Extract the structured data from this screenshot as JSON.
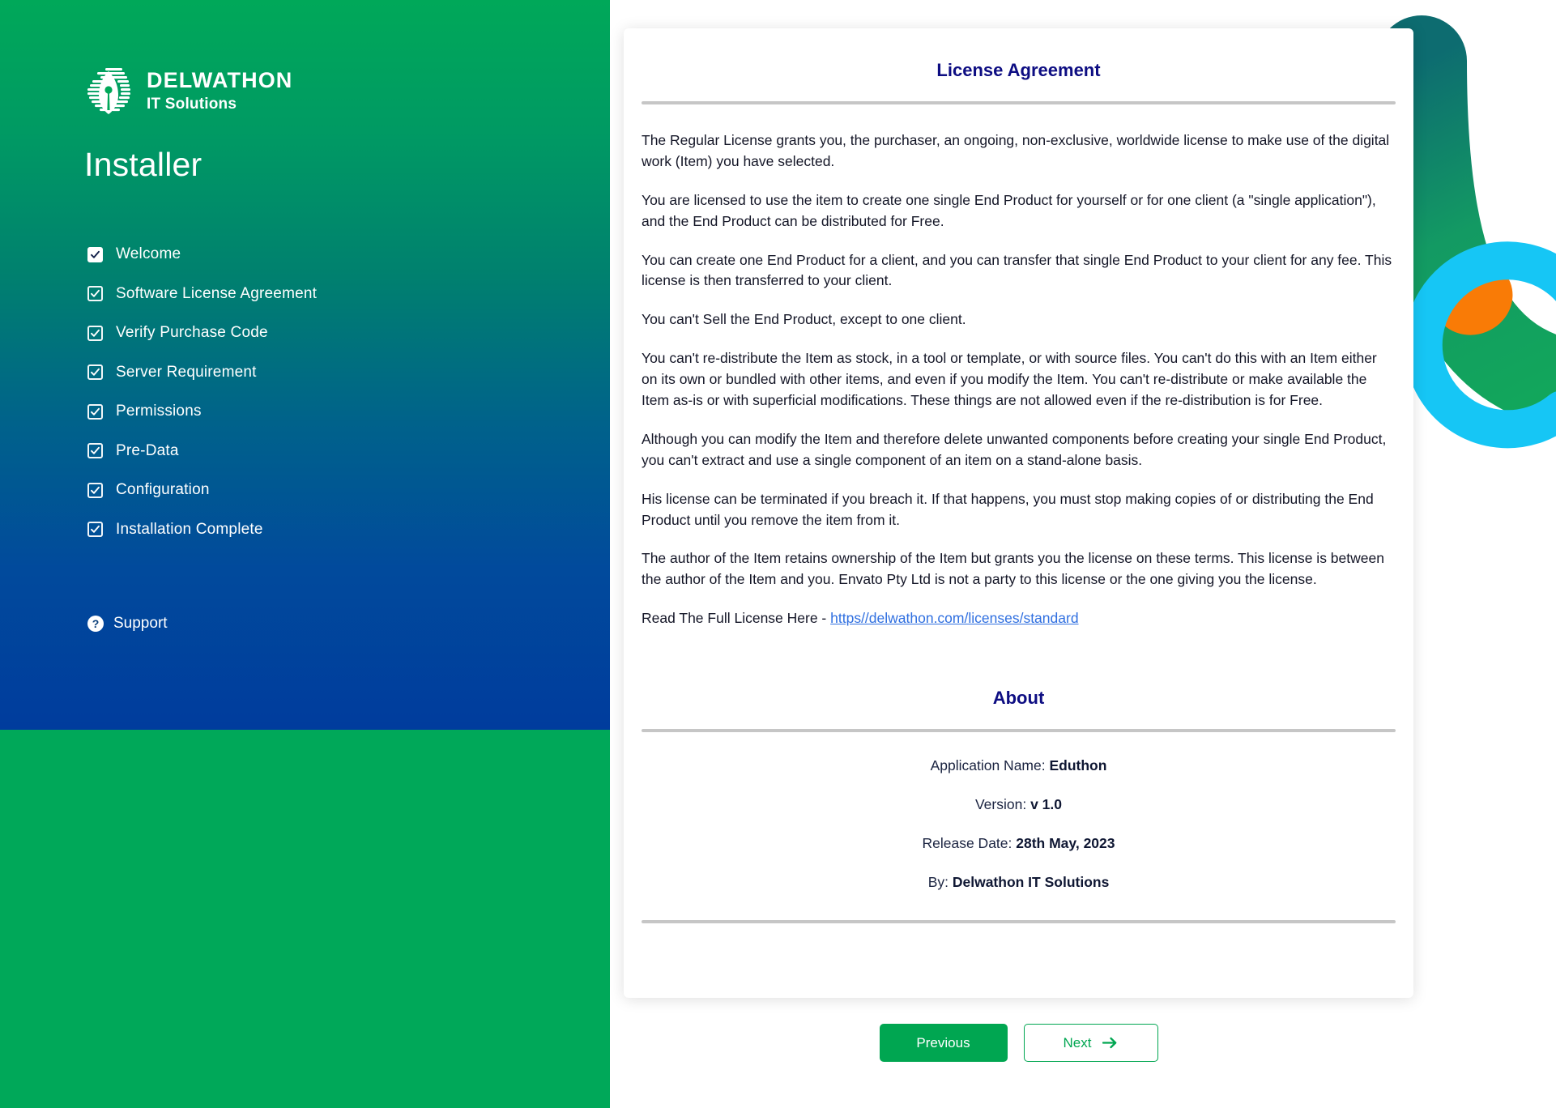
{
  "brand": {
    "logo_icon": "delwathon-pen-nib-logo",
    "name": "DELWATHON",
    "subtitle": "IT Solutions"
  },
  "sidebar": {
    "title": "Installer",
    "steps": [
      {
        "label": "Welcome",
        "checked": true,
        "active": true,
        "icon": "check-icon"
      },
      {
        "label": "Software License Agreement",
        "checked": true,
        "active": false,
        "icon": "check-icon"
      },
      {
        "label": "Verify Purchase Code",
        "checked": true,
        "active": false,
        "icon": "check-icon"
      },
      {
        "label": "Server Requirement",
        "checked": true,
        "active": false,
        "icon": "check-icon"
      },
      {
        "label": "Permissions",
        "checked": true,
        "active": false,
        "icon": "check-icon"
      },
      {
        "label": "Pre-Data",
        "checked": true,
        "active": false,
        "icon": "check-icon"
      },
      {
        "label": "Configuration",
        "checked": true,
        "active": false,
        "icon": "check-icon"
      },
      {
        "label": "Installation Complete",
        "checked": true,
        "active": false,
        "icon": "check-icon"
      }
    ],
    "support": {
      "label": "Support",
      "icon": "question-mark-circle-icon"
    }
  },
  "license": {
    "title": "License Agreement",
    "paragraphs": [
      "The Regular License grants you, the purchaser, an ongoing, non-exclusive, worldwide license to make use of the digital work (Item) you have selected.",
      "You are licensed to use the item to create one single End Product for yourself or for one client (a \"single application\"), and the End Product can be distributed for Free.",
      "You can create one End Product for a client, and you can transfer that single End Product to your client for any fee. This license is then transferred to your client.",
      "You can't Sell the End Product, except to one client.",
      "You can't re-distribute the Item as stock, in a tool or template, or with source files. You can't do this with an Item either on its own or bundled with other items, and even if you modify the Item. You can't re-distribute or make available the Item as-is or with superficial modifications. These things are not allowed even if the re-distribution is for Free.",
      "Although you can modify the Item and therefore delete unwanted components before creating your single End Product, you can't extract and use a single component of an item on a stand-alone basis.",
      "His license can be terminated if you breach it. If that happens, you must stop making copies of or distributing the End Product until you remove the item from it.",
      "The author of the Item retains ownership of the Item but grants you the license on these terms. This license is between the author of the Item and you. Envato Pty Ltd is not a party to this license or the one giving you the license."
    ],
    "full_license_prefix": "Read The Full License Here - ",
    "full_license_link": "https//delwathon.com/licenses/standard"
  },
  "about": {
    "title": "About",
    "rows": [
      {
        "label": "Application Name: ",
        "value": "Eduthon"
      },
      {
        "label": "Version: ",
        "value": "v 1.0"
      },
      {
        "label": "Release Date: ",
        "value": "28th May, 2023"
      },
      {
        "label": "By: ",
        "value": "Delwathon IT Solutions"
      }
    ]
  },
  "footer": {
    "previous_label": "Previous",
    "next_label": "Next",
    "next_icon": "arrow-right-icon"
  },
  "colors": {
    "green": "#00a651",
    "sidebar_top": "#00a859",
    "sidebar_bottom": "#003c9d",
    "navy_heading": "#0d0d82",
    "link": "#2f6fe0",
    "decor_orange": "#f97b06",
    "decor_cyan": "#16c6f5",
    "decor_green": "#17a05f"
  }
}
